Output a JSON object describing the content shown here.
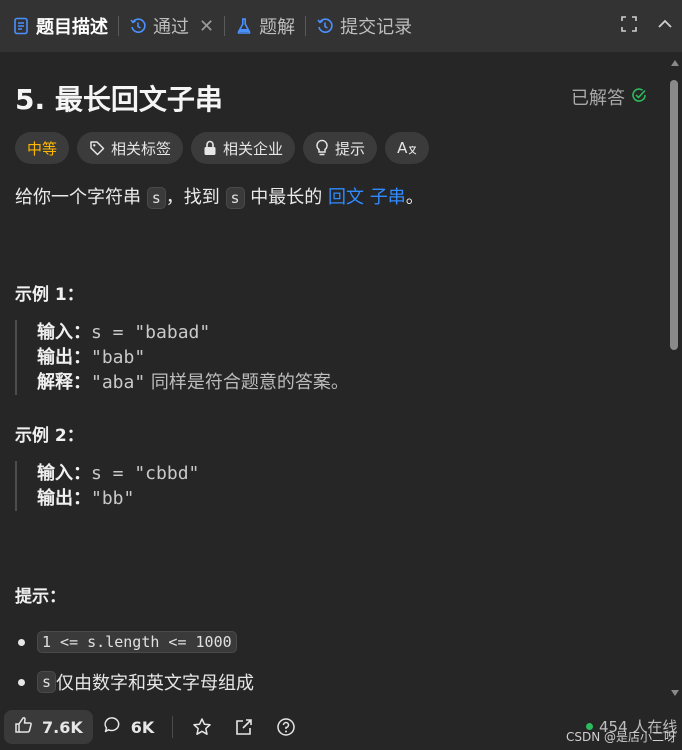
{
  "tabs": [
    {
      "label": "题目描述",
      "icon": "document-icon"
    },
    {
      "label": "通过",
      "icon": "history-icon"
    },
    {
      "label": "题解",
      "icon": "flask-icon"
    },
    {
      "label": "提交记录",
      "icon": "history-icon"
    }
  ],
  "close_symbol": "✕",
  "problem": {
    "title": "5. 最长回文子串",
    "status": "已解答",
    "tags": [
      "中等",
      "相关标签",
      "相关企业",
      "提示"
    ],
    "translate_label": "A",
    "desc": {
      "p1": "给你一个字符串 ",
      "code1": "s",
      "p2": "，找到 ",
      "code2": "s",
      "p3": " 中最长的 ",
      "link1": "回文",
      "space": " ",
      "link2": "子串",
      "p4": "。"
    }
  },
  "examples": [
    {
      "heading": "示例 1：",
      "input_label": "输入：",
      "input": "s = \"babad\"",
      "output_label": "输出：",
      "output": "\"bab\"",
      "explain_label": "解释：",
      "explain_code": "\"aba\"",
      "explain_text": " 同样是符合题意的答案。"
    },
    {
      "heading": "示例 2：",
      "input_label": "输入：",
      "input": "s = \"cbbd\"",
      "output_label": "输出：",
      "output": "\"bb\""
    }
  ],
  "hints": {
    "heading": "提示：",
    "item1_code": "1 <= s.length <= 1000",
    "item2_code": "s",
    "item2_text": " 仅由数字和英文字母组成"
  },
  "footer": {
    "likes": "7.6K",
    "comments": "6K",
    "online": "454 人在线",
    "watermark": "CSDN @是店小二呀"
  },
  "colors": {
    "difficulty": "#ffb800",
    "link": "#2f8bff",
    "online_dot": "#2cbb5d",
    "solved_check": "#2cbb5d"
  }
}
